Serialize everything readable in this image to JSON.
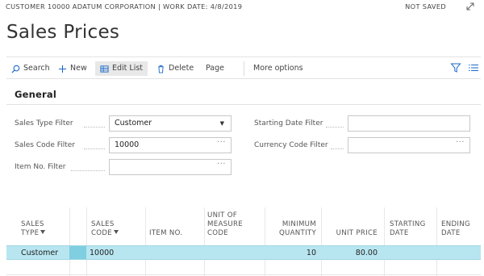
{
  "header": {
    "context": "CUSTOMER 10000 ADATUM CORPORATION | WORK DATE: 4/8/2019",
    "status": "NOT SAVED",
    "title": "Sales Prices"
  },
  "actions": {
    "search": "Search",
    "new": "New",
    "edit_list": "Edit List",
    "delete": "Delete",
    "page": "Page",
    "more": "More options"
  },
  "general": {
    "title": "General",
    "sales_type_label": "Sales Type Filter",
    "sales_type_value": "Customer",
    "sales_code_label": "Sales Code Filter",
    "sales_code_value": "10000",
    "item_no_label": "Item No. Filter",
    "item_no_value": "",
    "starting_date_label": "Starting Date Filter",
    "starting_date_value": "",
    "currency_label": "Currency Code Filter",
    "currency_value": ""
  },
  "grid": {
    "columns": {
      "sales_type_1": "SALES",
      "sales_type_2": "TYPE",
      "sales_code_1": "SALES",
      "sales_code_2": "CODE",
      "item_no": "ITEM NO.",
      "uom_1": "UNIT OF",
      "uom_2": "MEASURE",
      "uom_3": "CODE",
      "min_qty_1": "MINIMUM",
      "min_qty_2": "QUANTITY",
      "unit_price": "UNIT PRICE",
      "start_1": "STARTING",
      "start_2": "DATE",
      "end_1": "ENDING",
      "end_2": "DATE"
    },
    "rows": [
      {
        "sales_type": "Customer",
        "sales_code": "10000",
        "item_no": "",
        "uom": "",
        "min_qty": "10",
        "unit_price": "80.00",
        "starting_date": "",
        "ending_date": ""
      }
    ]
  },
  "colors": {
    "selected_row": "#b8e6f0",
    "row_marker": "#7fcfe0",
    "accent": "#1b6ac9"
  },
  "icons": [
    "expand-icon",
    "search-icon",
    "plus-icon",
    "edit-list-icon",
    "delete-icon",
    "filter-icon",
    "list-icon",
    "dropdown-caret-icon",
    "ellipsis-icon"
  ]
}
